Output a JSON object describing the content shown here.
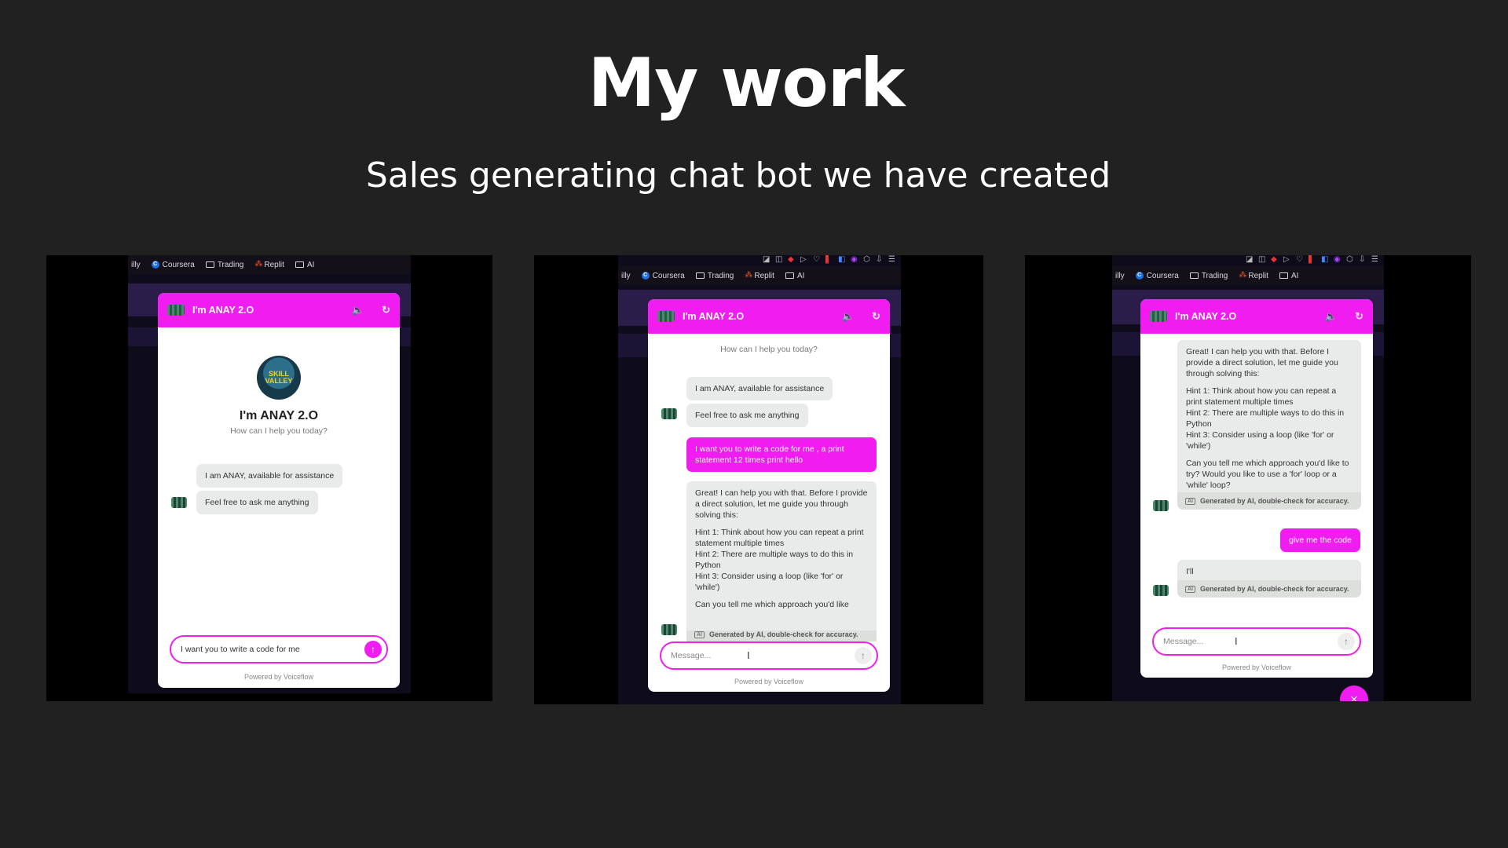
{
  "page": {
    "title": "My work",
    "subtitle": "Sales generating chat bot we have created"
  },
  "bookmarks": [
    {
      "label": "illy",
      "icon": "none"
    },
    {
      "label": "Coursera",
      "icon": "coursera-icon"
    },
    {
      "label": "Trading",
      "icon": "folder-icon"
    },
    {
      "label": "Replit",
      "icon": "replit-icon"
    },
    {
      "label": "AI",
      "icon": "folder-icon"
    }
  ],
  "chat": {
    "bot_name": "I'm ANAY 2.O",
    "welcome_name": "I'm ANAY 2.O",
    "welcome_sub": "How can I help you today?",
    "logo_text": "SKILL VALLEY",
    "greeting_1": "I am ANAY, available for assistance",
    "greeting_2": "Feel free to ask me anything",
    "user_msg_1": "I want you to write a code for me , a print statement 12 times print hello",
    "bot_reply_intro": "Great! I can help you with that. Before I provide a direct solution, let me guide you through solving this:",
    "bot_reply_hints": "Hint 1: Think about how you can repeat a print statement multiple times\nHint 2: There are multiple ways to do this in Python\nHint 3: Consider using a loop (like 'for' or 'while')",
    "bot_reply_question_partial": "Can you tell me which approach you'd like",
    "bot_reply_question": "Can you tell me which approach you'd like to try? Would you like to use a 'for' loop or a 'while' loop?",
    "ai_note": "Generated by AI, double-check for accuracy.",
    "ai_badge": "AI",
    "user_msg_2": "give me the code",
    "bot_reply_2": "I'll",
    "input_typed": "I want you to write a code for me",
    "input_placeholder": "Message...",
    "powered_by": "Powered by Voiceflow"
  },
  "colors": {
    "background": "#202120",
    "accent": "#f01cf0"
  }
}
